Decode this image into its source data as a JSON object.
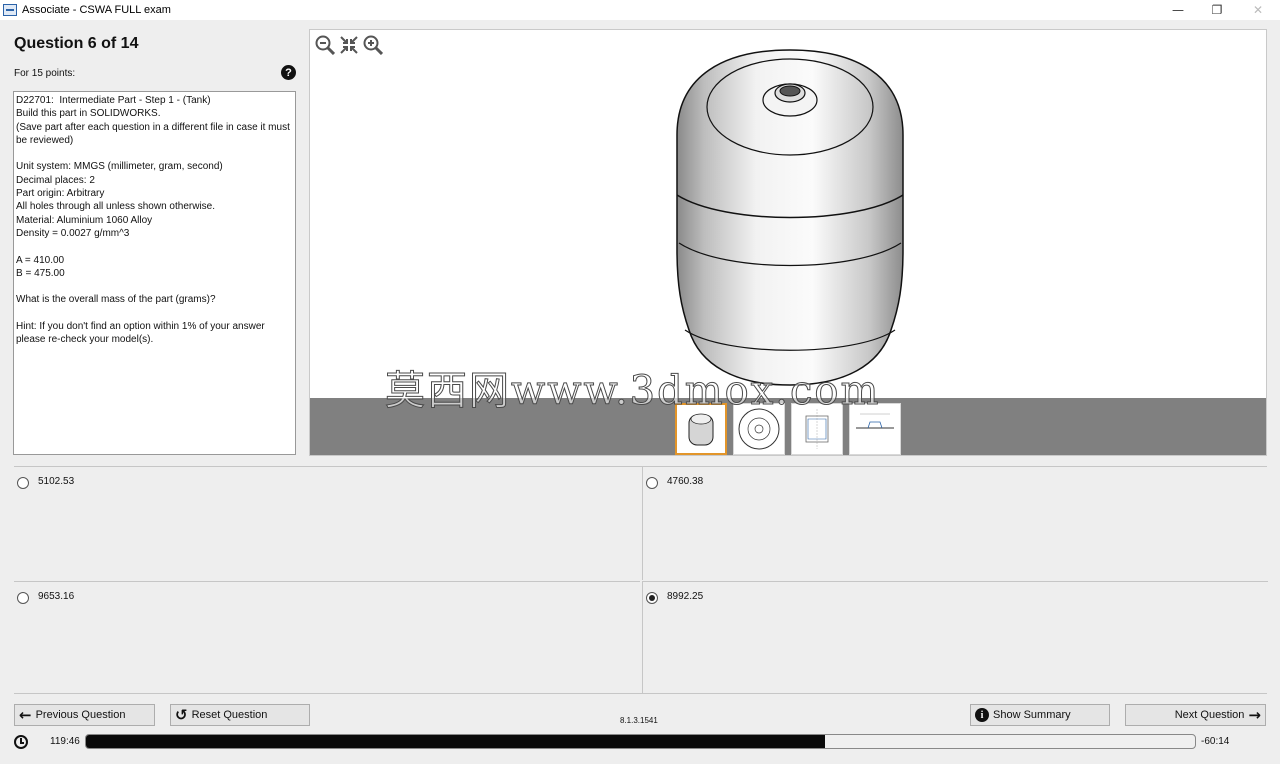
{
  "window": {
    "title": "Associate - CSWA FULL exam",
    "controls": {
      "minimize": "—",
      "restore": "❐",
      "close": "✕"
    }
  },
  "question": {
    "heading": "Question 6 of 14",
    "points": "For 15 points:",
    "help_glyph": "?",
    "text_lines": [
      "D22701:  Intermediate Part - Step 1 - (Tank)",
      "Build this part in SOLIDWORKS.",
      "(Save part after each question in a different file in case it must be reviewed)",
      "",
      "Unit system: MMGS (millimeter, gram, second)",
      "Decimal places: 2",
      "Part origin: Arbitrary",
      "All holes through all unless shown otherwise.",
      "Material: Aluminium 1060 Alloy",
      "Density = 0.0027 g/mm^3",
      "",
      "A = 410.00",
      "B = 475.00",
      "",
      "What is the overall mass of the part (grams)?",
      "",
      "Hint: If you don't find an option within 1% of your answer please re-check your model(s)."
    ]
  },
  "viewer": {
    "tools": [
      "zoom-out-icon",
      "fit-icon",
      "zoom-in-icon"
    ],
    "thumbnails": [
      {
        "name": "isometric view",
        "selected": true
      },
      {
        "name": "top view",
        "selected": false
      },
      {
        "name": "section view",
        "selected": false
      },
      {
        "name": "detail view",
        "selected": false
      }
    ],
    "watermark": "莫西网www.3dmox.com"
  },
  "answers": [
    {
      "label": "5102.53",
      "selected": false
    },
    {
      "label": "4760.38",
      "selected": false
    },
    {
      "label": "9653.16",
      "selected": false
    },
    {
      "label": "8992.25",
      "selected": true
    }
  ],
  "buttons": {
    "previous": "Previous Question",
    "reset": "Reset Question",
    "summary": "Show Summary",
    "next": "Next Question",
    "info_glyph": "i",
    "prev_arrow": "←",
    "reset_arrow": "↺",
    "next_arrow": "→"
  },
  "version": "8.1.3.1541",
  "timer": {
    "elapsed": "119:46",
    "remaining": "-60:14",
    "progress_fraction": 0.666
  },
  "colors": {
    "selected_thumb_border": "#e2952a",
    "thumb_strip": "#808080",
    "progress_fill": "#0a0a0a"
  }
}
